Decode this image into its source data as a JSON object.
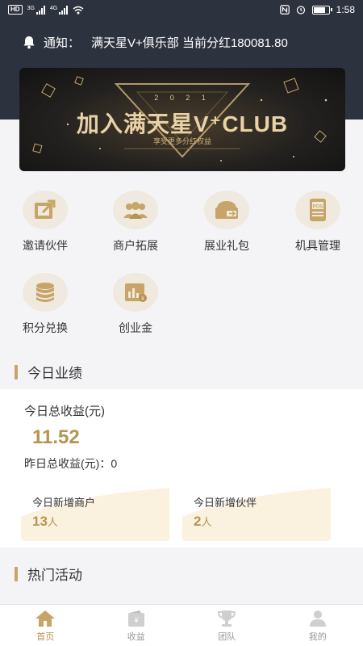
{
  "status_bar": {
    "left_badge": "HD",
    "net1": "3G",
    "net2": "4G",
    "time": "1:58",
    "battery_level": 0.8
  },
  "notice": {
    "label": "通知：",
    "text": "满天星V+俱乐部 当前分红180081.80"
  },
  "banner": {
    "year": "2 0 2 1",
    "title": "加入满天星V⁺CLUB",
    "subtitle": "享受更多分红权益"
  },
  "menu": [
    {
      "label": "邀请伙伴",
      "icon": "share-icon"
    },
    {
      "label": "商户拓展",
      "icon": "users-icon"
    },
    {
      "label": "展业礼包",
      "icon": "gift-box-icon"
    },
    {
      "label": "机具管理",
      "icon": "pos-terminal-icon"
    },
    {
      "label": "积分兑换",
      "icon": "coin-stack-icon"
    },
    {
      "label": "创业金",
      "icon": "chart-money-icon"
    }
  ],
  "today": {
    "section_title": "今日业绩",
    "total_label": "今日总收益(元)",
    "total_value": "11.52",
    "yesterday_text": "昨日总收益(元)：0",
    "merchants": {
      "label": "今日新增商户",
      "value": "13",
      "unit": "人"
    },
    "partners": {
      "label": "今日新增伙伴",
      "value": "2",
      "unit": "人"
    }
  },
  "hot": {
    "section_title": "热门活动"
  },
  "tabs": [
    {
      "label": "首页",
      "icon": "home-icon",
      "active": true
    },
    {
      "label": "收益",
      "icon": "wallet-icon",
      "active": false
    },
    {
      "label": "团队",
      "icon": "trophy-icon",
      "active": false
    },
    {
      "label": "我的",
      "icon": "person-icon",
      "active": false
    }
  ],
  "colors": {
    "accent": "#b8934f",
    "header_bg": "#2d323f",
    "icon_bg": "#efe9df"
  }
}
